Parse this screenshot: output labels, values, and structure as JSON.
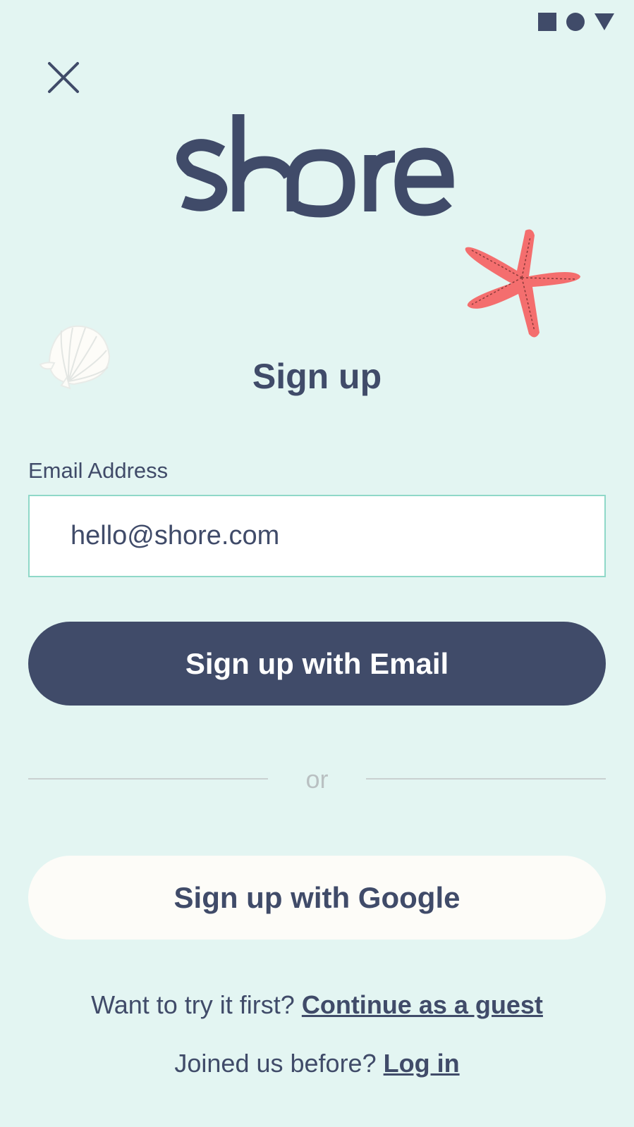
{
  "status_bar": {
    "icons": [
      "square-icon",
      "circle-icon",
      "triangle-icon"
    ]
  },
  "header": {
    "close_icon": "close-icon"
  },
  "logo": {
    "text": "shore"
  },
  "decorations": {
    "starfish": "starfish-illustration",
    "shell": "seashell-illustration"
  },
  "form": {
    "title": "Sign up",
    "email_label": "Email Address",
    "email_value": "hello@shore.com"
  },
  "actions": {
    "email_button": "Sign up with Email",
    "divider_text": "or",
    "google_button": "Sign up with Google"
  },
  "footer": {
    "guest_prompt": "Want to try it first?",
    "guest_link": "Continue as a guest",
    "login_prompt": "Joined us before?",
    "login_link": "Log in"
  },
  "colors": {
    "background": "#e3f5f2",
    "primary": "#404b69",
    "accent_starfish": "#f46e6e",
    "input_border": "#8fd8c8"
  }
}
